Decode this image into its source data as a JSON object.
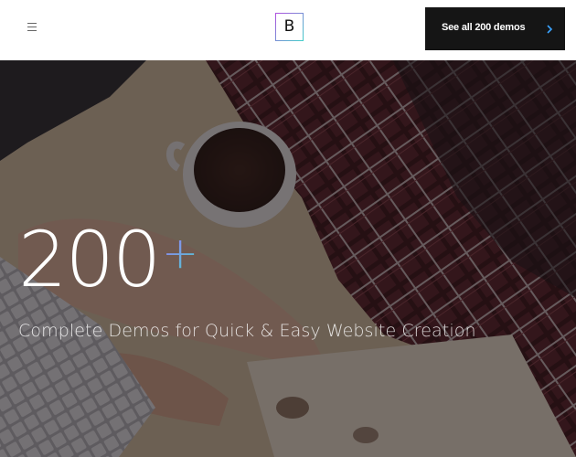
{
  "header": {
    "menu_icon": "hamburger-menu-icon",
    "logo_letter": "B",
    "logo_gradient": [
      "#b14de0",
      "#3fd0c9"
    ],
    "cta_label": "See all 200 demos",
    "cta_icon": "chevron-right-icon",
    "cta_bg": "#151515",
    "chevron_color": "#3aa3ff"
  },
  "hero": {
    "big_number": "200",
    "plus": "+",
    "subtitle": "Complete Demos for Quick & Easy Website Creation"
  }
}
